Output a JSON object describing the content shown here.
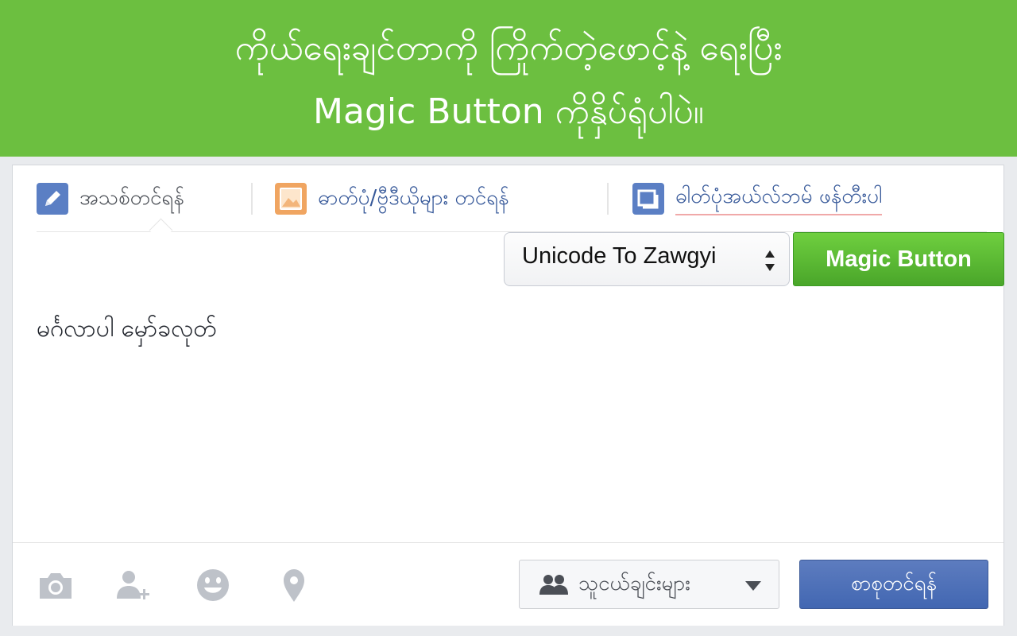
{
  "banner": {
    "line1": "ကိုယ်ရေးချင်တာကို ကြိုက်တဲ့ဖောင့်နဲ့ ရေးပြီး",
    "line2": "Magic Button ကိုနှိပ်ရုံပါပဲ။"
  },
  "tabs": [
    {
      "label": "အသစ်တင်ရန်",
      "icon": "pencil-icon"
    },
    {
      "label": "ဓာတ်ပုံ/ဗွီဒီယိုများ တင်ရန်",
      "icon": "photo-icon"
    },
    {
      "label": "ဓါတ်ပုံအယ်လ်ဘမ် ဖန်တီးပါ",
      "icon": "album-icon"
    }
  ],
  "converter": {
    "selected": "Unicode To Zawgyi",
    "button_label": "Magic Button"
  },
  "editor": {
    "text": "မင်္ဂလာပါ မှော်ခလုတ်"
  },
  "footer": {
    "icons": [
      "camera-icon",
      "tag-friends-icon",
      "emoji-icon",
      "location-icon"
    ],
    "audience_label": "သူငယ်ချင်းများ",
    "post_label": "စာစုတင်ရန်"
  },
  "colors": {
    "banner_bg": "#6cbf40",
    "link_blue": "#365899",
    "magic_green": "#4aa62a",
    "post_blue": "#4267b2"
  }
}
